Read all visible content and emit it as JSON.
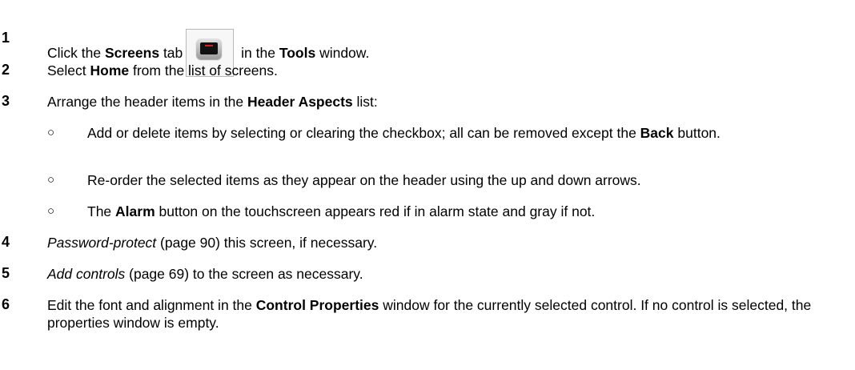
{
  "steps": [
    {
      "number": "1",
      "t1": "Click the ",
      "b1": "Screens",
      "t2": " tab",
      "icon": "screens-tab-icon",
      "t3": " in the ",
      "b2": "Tools",
      "t4": " window."
    },
    {
      "number": "2",
      "t1": "Select ",
      "b1": "Home",
      "t2": " from the list of screens."
    },
    {
      "number": "3",
      "t1": "Arrange the header items in the ",
      "b1": "Header Aspects",
      "t2": " list:",
      "bullets": [
        {
          "symbol": "○",
          "t1": "Add or delete items by selecting or clearing the checkbox; all can be removed except the ",
          "b1": "Back",
          "t2": " button."
        },
        {
          "symbol": "○",
          "t1": "Re-order the selected items as they appear on the header using the up and down arrows."
        },
        {
          "symbol": "○",
          "t1": "The ",
          "b1": "Alarm",
          "t2": " button on the touchscreen appears red if in alarm state and gray if not."
        }
      ]
    },
    {
      "number": "4",
      "link": "Password-protect",
      "t1": " (page 90) this screen, if necessary."
    },
    {
      "number": "5",
      "link": "Add controls",
      "t1": " (page 69) to the screen as necessary."
    },
    {
      "number": "6",
      "t1": "Edit the font and alignment in the ",
      "b1": "Control Properties",
      "t2": " window for the currently selected control. If no control is selected, the properties window is empty."
    }
  ]
}
